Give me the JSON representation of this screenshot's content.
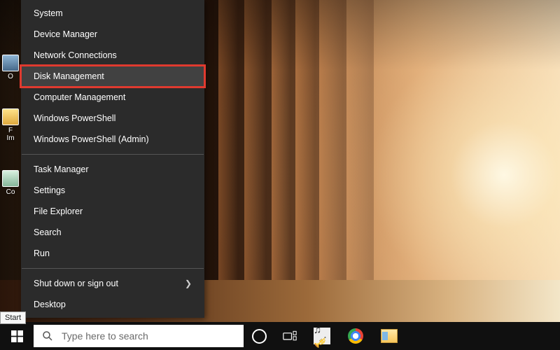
{
  "desktop_icons": {
    "label_0": "O",
    "label_1": "F",
    "label_1b": "Im",
    "label_2": "Co"
  },
  "winx": {
    "items": [
      {
        "label": "System"
      },
      {
        "label": "Device Manager"
      },
      {
        "label": "Network Connections"
      },
      {
        "label": "Disk Management"
      },
      {
        "label": "Computer Management"
      },
      {
        "label": "Windows PowerShell"
      },
      {
        "label": "Windows PowerShell (Admin)"
      }
    ],
    "items2": [
      {
        "label": "Task Manager"
      },
      {
        "label": "Settings"
      },
      {
        "label": "File Explorer"
      },
      {
        "label": "Search"
      },
      {
        "label": "Run"
      }
    ],
    "items3": [
      {
        "label": "Shut down or sign out",
        "submenu": true
      },
      {
        "label": "Desktop"
      }
    ],
    "highlight_index": 3
  },
  "tooltip": {
    "start": "Start"
  },
  "taskbar": {
    "search_placeholder": "Type here to search"
  }
}
